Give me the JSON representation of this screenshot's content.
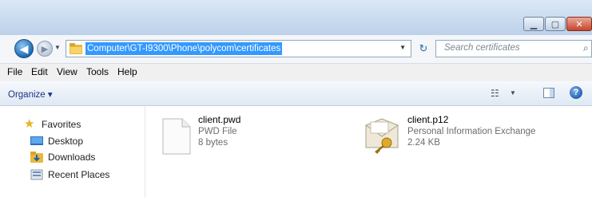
{
  "address": {
    "path": "Computer\\GT-I9300\\Phone\\polycom\\certificates"
  },
  "search": {
    "placeholder": "Search certificates"
  },
  "menu": [
    "File",
    "Edit",
    "View",
    "Tools",
    "Help"
  ],
  "toolbar": {
    "organize": "Organize ▾"
  },
  "nav": {
    "favorites": "Favorites",
    "items": [
      "Desktop",
      "Downloads",
      "Recent Places"
    ]
  },
  "files": [
    {
      "name": "client.pwd",
      "type": "PWD File",
      "size": "8 bytes",
      "icon": "blank-file-icon"
    },
    {
      "name": "client.p12",
      "type": "Personal Information Exchange",
      "size": "2.24 KB",
      "icon": "certificate-key-icon"
    }
  ],
  "colors": {
    "selection": "#3399ff",
    "titlebar": "#c9dbef",
    "close": "#c7442b"
  }
}
